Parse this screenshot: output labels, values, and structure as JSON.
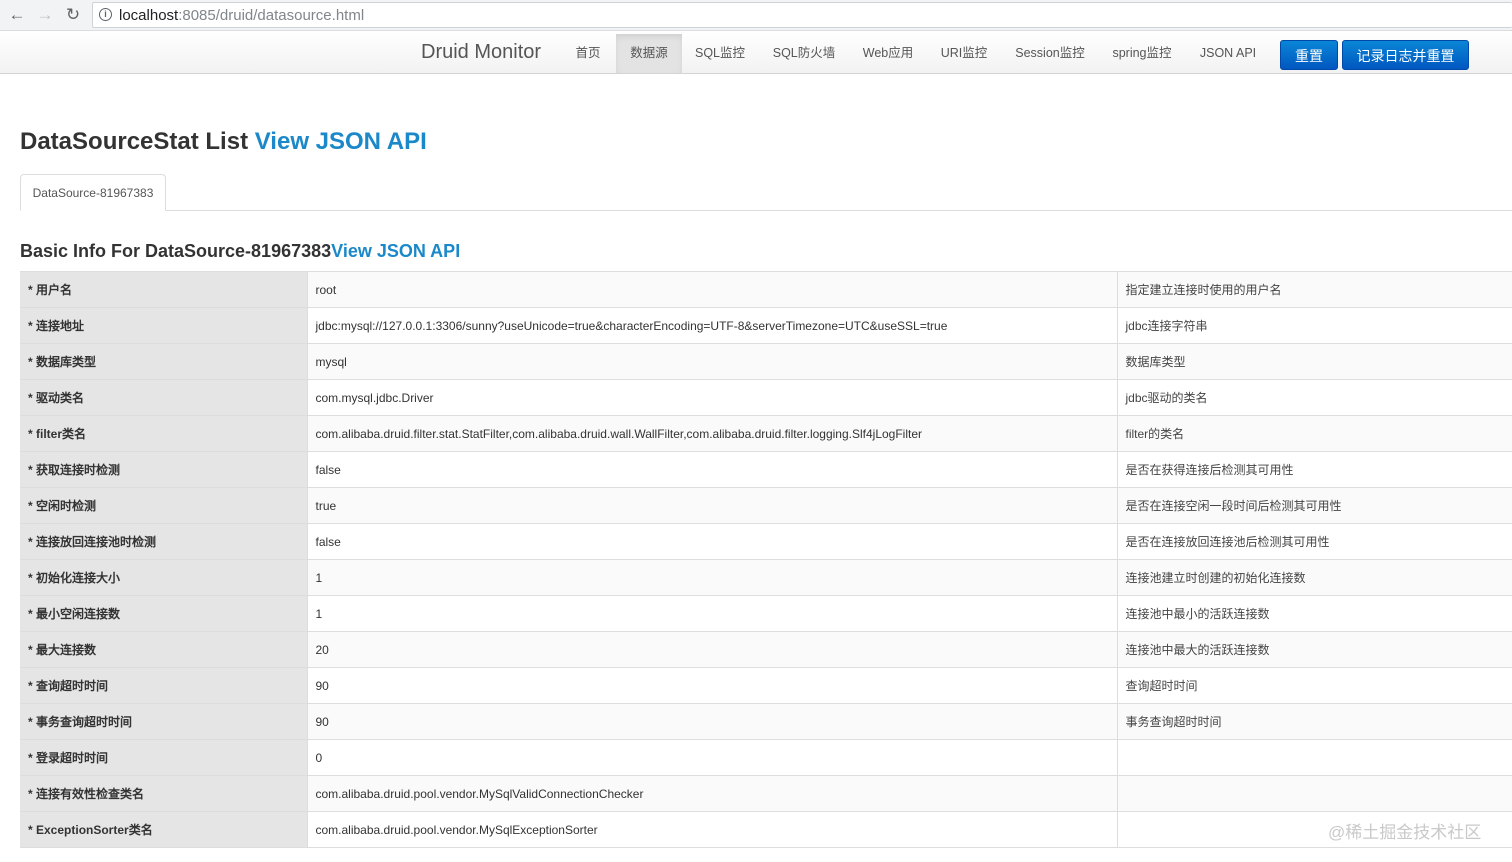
{
  "browser": {
    "url_host": "localhost",
    "url_rest": ":8085/druid/datasource.html"
  },
  "navbar": {
    "brand": "Druid Monitor",
    "items": [
      {
        "label": "首页"
      },
      {
        "label": "数据源"
      },
      {
        "label": "SQL监控"
      },
      {
        "label": "SQL防火墙"
      },
      {
        "label": "Web应用"
      },
      {
        "label": "URI监控"
      },
      {
        "label": "Session监控"
      },
      {
        "label": "spring监控"
      },
      {
        "label": "JSON API"
      }
    ],
    "reset_label": "重置",
    "log_reset_label": "记录日志并重置"
  },
  "page": {
    "title": "DataSourceStat List",
    "title_link": "View JSON API",
    "tab_label": "DataSource-81967383",
    "subtitle": "Basic Info For DataSource-81967383",
    "subtitle_link": "View JSON API"
  },
  "table": {
    "rows": [
      {
        "key": "* 用户名",
        "value": "root",
        "desc": "指定建立连接时使用的用户名"
      },
      {
        "key": "* 连接地址",
        "value": "jdbc:mysql://127.0.0.1:3306/sunny?useUnicode=true&characterEncoding=UTF-8&serverTimezone=UTC&useSSL=true",
        "desc": "jdbc连接字符串"
      },
      {
        "key": "* 数据库类型",
        "value": "mysql",
        "desc": "数据库类型"
      },
      {
        "key": "* 驱动类名",
        "value": "com.mysql.jdbc.Driver",
        "desc": "jdbc驱动的类名"
      },
      {
        "key": "* filter类名",
        "value": "com.alibaba.druid.filter.stat.StatFilter,com.alibaba.druid.wall.WallFilter,com.alibaba.druid.filter.logging.Slf4jLogFilter",
        "desc": "filter的类名"
      },
      {
        "key": "* 获取连接时检测",
        "value": "false",
        "desc": "是否在获得连接后检测其可用性"
      },
      {
        "key": "* 空闲时检测",
        "value": "true",
        "desc": "是否在连接空闲一段时间后检测其可用性"
      },
      {
        "key": "* 连接放回连接池时检测",
        "value": "false",
        "desc": "是否在连接放回连接池后检测其可用性"
      },
      {
        "key": "* 初始化连接大小",
        "value": "1",
        "desc": "连接池建立时创建的初始化连接数"
      },
      {
        "key": "* 最小空闲连接数",
        "value": "1",
        "desc": "连接池中最小的活跃连接数"
      },
      {
        "key": "* 最大连接数",
        "value": "20",
        "desc": "连接池中最大的活跃连接数"
      },
      {
        "key": "* 查询超时时间",
        "value": "90",
        "desc": "查询超时时间"
      },
      {
        "key": "* 事务查询超时时间",
        "value": "90",
        "desc": "事务查询超时时间"
      },
      {
        "key": "* 登录超时时间",
        "value": "0",
        "desc": ""
      },
      {
        "key": "* 连接有效性检查类名",
        "value": "com.alibaba.druid.pool.vendor.MySqlValidConnectionChecker",
        "desc": ""
      },
      {
        "key": "* ExceptionSorter类名",
        "value": "com.alibaba.druid.pool.vendor.MySqlExceptionSorter",
        "desc": ""
      }
    ]
  },
  "watermark": "@稀土掘金技术社区"
}
